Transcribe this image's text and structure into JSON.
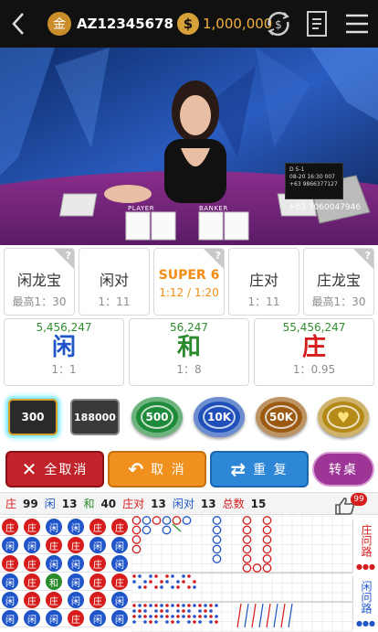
{
  "header": {
    "level_badge": "金",
    "username": "AZ12345678",
    "currency_symbol": "$",
    "balance": "1,000,000"
  },
  "video": {
    "phone": "+63 7060047946",
    "board_line1": "D        5-1",
    "board_line2": "08-20 16:30 007",
    "board_line3": "+63 9866377127",
    "player_label": "PLAYER",
    "banker_label": "BANKER"
  },
  "side_bets": [
    {
      "name": "闲龙宝",
      "odds": "最高1：30",
      "highlight": false,
      "help": true
    },
    {
      "name": "闲对",
      "odds": "1：11",
      "highlight": false,
      "help": false
    },
    {
      "name": "SUPER 6",
      "odds": "1:12 / 1:20",
      "highlight": true,
      "help": true
    },
    {
      "name": "庄对",
      "odds": "1：11",
      "highlight": false,
      "help": false
    },
    {
      "name": "庄龙宝",
      "odds": "最高1：30",
      "highlight": false,
      "help": true
    }
  ],
  "main_bets": [
    {
      "name": "闲",
      "amount": "5,456,247",
      "odds": "1：1",
      "color": "#1f55c8"
    },
    {
      "name": "和",
      "amount": "56,247",
      "odds": "1：8",
      "color": "#2b8a2b"
    },
    {
      "name": "庄",
      "amount": "55,456,247",
      "odds": "1：0.95",
      "color": "#d61c1c"
    }
  ],
  "chips": [
    {
      "label": "300",
      "selected": true
    },
    {
      "label": "188000"
    },
    {
      "label": "500",
      "color": "#1e8a3a"
    },
    {
      "label": "10K",
      "color": "#1f4fb8"
    },
    {
      "label": "50K",
      "color": "#9a5a12"
    },
    {
      "label": "",
      "color": "#b58a18",
      "icon": "heart-icon"
    }
  ],
  "actions": {
    "cancel_all": "全取消",
    "cancel": "取 消",
    "repeat": "重 复",
    "switch_table": "转桌"
  },
  "stats": {
    "banker_label": "庄",
    "banker": "99",
    "player_label": "闲",
    "player": "13",
    "tie_label": "和",
    "tie": "40",
    "banker_pair_label": "庄对",
    "banker_pair": "13",
    "player_pair_label": "闲对",
    "player_pair": "13",
    "total_label": "总数",
    "total": "15",
    "like_count": "99"
  },
  "road": {
    "banker_ask": "庄问路",
    "player_ask": "闲问路",
    "bead_rows": [
      [
        "庄",
        "庄",
        "闲",
        "闲",
        "庄",
        "庄"
      ],
      [
        "闲",
        "闲",
        "庄",
        "庄",
        "闲",
        "闲"
      ],
      [
        "庄",
        "庄",
        "闲",
        "闲",
        "庄",
        "闲"
      ],
      [
        "闲",
        "庄",
        "和",
        "闲",
        "庄",
        "庄"
      ],
      [
        "闲",
        "庄",
        "庄",
        "闲",
        "庄",
        "闲"
      ],
      [
        "闲",
        "闲",
        "闲",
        "庄",
        "闲",
        "闲"
      ]
    ]
  },
  "colors": {
    "banker": "#d61c1c",
    "player": "#1f55c8",
    "tie": "#2b8a2b",
    "gold": "#f0b23c"
  }
}
